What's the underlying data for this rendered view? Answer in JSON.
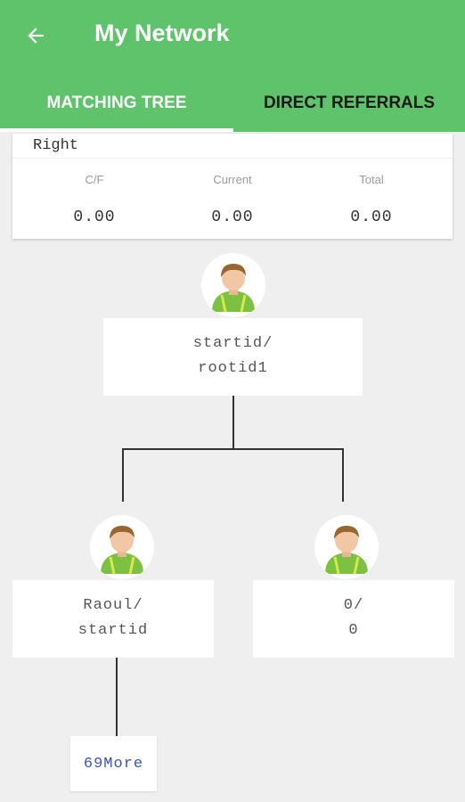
{
  "app_bar": {
    "title": "My Network",
    "back_icon": "arrow-left-icon",
    "background_color": "#5fc36c"
  },
  "tabs": [
    {
      "label": "MATCHING TREE",
      "selected": true
    },
    {
      "label": "DIRECT REFERRALS",
      "selected": false
    }
  ],
  "summary": {
    "side": "Right",
    "columns": [
      {
        "label": "C/F",
        "value": "0.00"
      },
      {
        "label": "Current",
        "value": "0.00"
      },
      {
        "label": "Total",
        "value": "0.00"
      }
    ]
  },
  "tree": {
    "root": {
      "line1": "startid/",
      "line2": "rootid1",
      "avatar_icon": "user-avatar-icon"
    },
    "left": {
      "line1": "Raoul/",
      "line2": "startid",
      "avatar_icon": "user-avatar-icon"
    },
    "right": {
      "line1": "0/",
      "line2": "0",
      "avatar_icon": "user-avatar-icon"
    },
    "more": {
      "label": "69More",
      "color": "#3a55b5"
    }
  }
}
